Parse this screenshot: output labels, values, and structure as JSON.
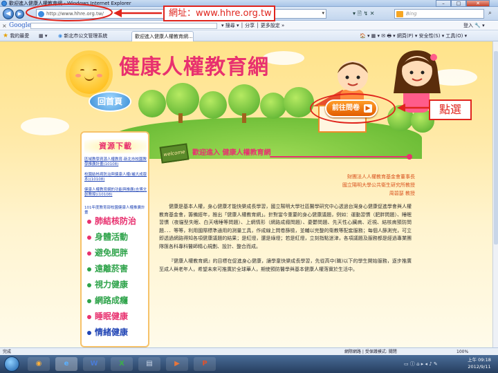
{
  "browser": {
    "window_title": "歡迎進入健康人權教育網 - Windows Internet Explorer",
    "url": "http://www.hhre.org.tw/",
    "search_placeholder": "Bing",
    "addr_tools": "▾ 🗎 ↯ ✕",
    "url_callout": "網址：www.hhre.org.tw",
    "google_label": "Google",
    "google_tools": "▾ 搜尋 ▾ │ 分享 │ 更多設定 »",
    "sign_in": "登入 🔧 ▾",
    "favorites": "我的最愛",
    "fav_item_1": "新北市公文管理系統",
    "fav_item_2": "歡迎進入健康人權教育...",
    "tab_label": "歡迎進入健康人權教育網...",
    "cmd_bar": "🏠 ▾  ▦ ▾  ✉  🖶 ▾  網頁(P) ▾  安全性(S) ▾  工具(O) ▾",
    "status_left": "完成",
    "status_zone": "網際網路 | 受保護模式: 關閉",
    "zoom": "100%"
  },
  "site": {
    "title": "健康人權教育網",
    "home_button": "回首頁",
    "survey_button": "前往問卷",
    "click_callout": "點選",
    "sidebar_heading": "資源下載",
    "sidebar_links": [
      "區域教學資源人權教育-新北市校園教學推廣計畫(10108)",
      "校園結核病防治與健康人權(補大成版本)(10108)",
      "健康人權教育網的功能與推廣(吉博文創教授)(10108)"
    ],
    "sidebar_note": "101年度教育部校園健康人權推廣計畫",
    "topics": [
      "肺結核防治",
      "身體活動",
      "避免肥胖",
      "遠離菸害",
      "視力健康",
      "網路成癮",
      "睡眠健康",
      "情緒健康"
    ],
    "welcome_sign": "welcome",
    "welcome_title": "歡迎進入 健康人權教育網",
    "credit_1": "財團法人人權教育基金會董事長",
    "credit_2": "國立陽明大學公共衛生研究所教授",
    "credit_3": "周碧瑟 教授",
    "paragraph_1": "健康是基本人權，身心健康才能快樂成長學習，國立陽明大學社區醫學研究中心透過台灣身心健康促進學會與人權教育基金會，籌備經年，推出「健康人權教育網」。針對當今重要的身心健康議題，例如：運動習慣（肥胖問題）、睡眠習慣（夜貓型失眠、白天嗜睡等問題）、上網情形（網路成癮問題）、憂鬱問題、先天性心臟病、近視、結核病預防問題．．．等等，利用國際標準通用的測量工具，作成線上問卷篩檢，並輔以完整的衛教等配套服務；每個人篩測完，可立即透過網路得知各項健康議題的結果；是紅燈，還是綠燈；若是紅燈，立刻指點迷津，各項議題及服務都是經過專業團隊匯各科專科醫師精心規劃、設計、整合而成。",
    "paragraph_2": "『健康人權教育網』的目標在促進身心健康，讓學童快樂成長學習，先從高中(職)以下的學生開始服務，逐步推廣至成人與老年人，希望未來可推廣於全球華人，期使預防醫學與基本健康人權落實於生活中。"
  },
  "taskbar": {
    "time": "上午 09:18",
    "date": "2012/9/11"
  }
}
